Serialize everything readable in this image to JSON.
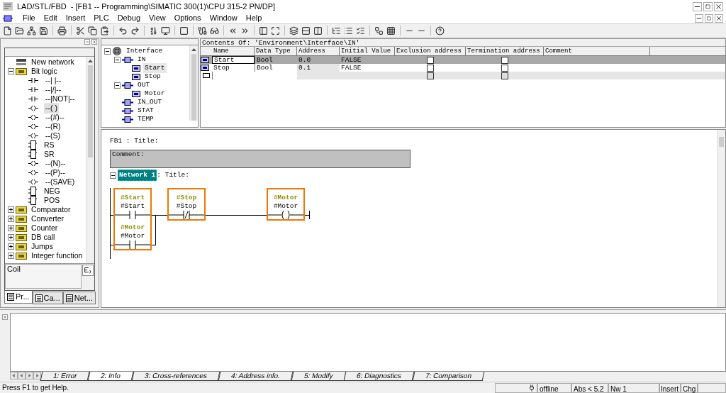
{
  "window": {
    "title": "LAD/STL/FBD  - [FB1 -- Programming\\SIMATIC 300(1)\\CPU 315-2 PN/DP]"
  },
  "menu": [
    "File",
    "Edit",
    "Insert",
    "PLC",
    "Debug",
    "View",
    "Options",
    "Window",
    "Help"
  ],
  "catalog": {
    "items": [
      {
        "label": "New network",
        "kind": "network",
        "selected": false
      },
      {
        "label": "Bit logic",
        "kind": "folder",
        "expanded": true,
        "selected": false,
        "children": [
          {
            "label": "--| |--",
            "kind": "contact",
            "selected": false
          },
          {
            "label": "--|/|--",
            "kind": "contact",
            "selected": false
          },
          {
            "label": "--|NOT|--",
            "kind": "contact",
            "selected": false
          },
          {
            "label": "--( )",
            "kind": "coil",
            "selected": true
          },
          {
            "label": "--(#)--",
            "kind": "coil",
            "selected": false
          },
          {
            "label": "--(R)",
            "kind": "coil",
            "selected": false
          },
          {
            "label": "--(S)",
            "kind": "coil",
            "selected": false
          },
          {
            "label": "RS",
            "kind": "box",
            "selected": false
          },
          {
            "label": "SR",
            "kind": "box",
            "selected": false
          },
          {
            "label": "--(N)--",
            "kind": "coil",
            "selected": false
          },
          {
            "label": "--(P)--",
            "kind": "coil",
            "selected": false
          },
          {
            "label": "--(SAVE)",
            "kind": "coil",
            "selected": false
          },
          {
            "label": "NEG",
            "kind": "box",
            "selected": false
          },
          {
            "label": "POS",
            "kind": "box",
            "selected": false
          }
        ]
      },
      {
        "label": "Comparator",
        "kind": "folder",
        "expanded": false,
        "selected": false
      },
      {
        "label": "Converter",
        "kind": "folder",
        "expanded": false,
        "selected": false
      },
      {
        "label": "Counter",
        "kind": "folder",
        "expanded": false,
        "selected": false
      },
      {
        "label": "DB call",
        "kind": "folder",
        "expanded": false,
        "selected": false
      },
      {
        "label": "Jumps",
        "kind": "folder",
        "expanded": false,
        "selected": false
      },
      {
        "label": "Integer function",
        "kind": "folder",
        "expanded": false,
        "selected": false
      }
    ],
    "description": "Coil",
    "tabs": [
      {
        "label": "Pr...",
        "selected": true
      },
      {
        "label": "Ca...",
        "selected": false
      },
      {
        "label": "Net...",
        "selected": false
      }
    ]
  },
  "interface": {
    "tree": [
      {
        "label": "Interface",
        "kind": "root",
        "expanded": true,
        "selected": false,
        "children": [
          {
            "label": "IN",
            "kind": "section",
            "expanded": true,
            "selected": false,
            "children": [
              {
                "label": "Start",
                "kind": "var",
                "selected": true
              },
              {
                "label": "Stop",
                "kind": "var",
                "selected": false
              }
            ]
          },
          {
            "label": "OUT",
            "kind": "section",
            "expanded": true,
            "selected": false,
            "children": [
              {
                "label": "Motor",
                "kind": "var",
                "selected": false
              }
            ]
          },
          {
            "label": "IN_OUT",
            "kind": "section",
            "selected": false
          },
          {
            "label": "STAT",
            "kind": "section",
            "selected": false
          },
          {
            "label": "TEMP",
            "kind": "section",
            "selected": false
          }
        ]
      }
    ],
    "path": "Contents Of: 'Environment\\Interface\\IN'",
    "columns": [
      "Name",
      "Data Type",
      "Address",
      "Initial Value",
      "Exclusion address",
      "Termination address",
      "Comment"
    ],
    "rows": [
      {
        "name": "Start",
        "type": "Bool",
        "address": "0.0",
        "initial": "FALSE",
        "exclusion": false,
        "termination": false,
        "selected": true
      },
      {
        "name": "Stop",
        "type": "Bool",
        "address": "0.1",
        "initial": "FALSE",
        "exclusion": false,
        "termination": false,
        "selected": false
      }
    ],
    "new_row": {
      "exclusion": false,
      "termination": false,
      "disabled": true
    }
  },
  "editor": {
    "block_title": "FB1 : Title:",
    "comment": "Comment:",
    "network": {
      "label": "Network 1",
      "title": ": Title:",
      "expanded": true,
      "parallel": {
        "highlighted": true,
        "contacts": [
          {
            "kind": "no",
            "symbol": "#Start",
            "operand": "#Start"
          },
          {
            "kind": "no",
            "symbol": "#Motor",
            "operand": "#Motor"
          }
        ]
      },
      "series": [
        {
          "kind": "nc",
          "symbol": "#Stop",
          "operand": "#Stop",
          "highlighted": true
        }
      ],
      "coil": {
        "kind": "coil",
        "symbol": "#Motor",
        "operand": "#Motor",
        "highlighted": true
      }
    }
  },
  "output": {
    "tabs": [
      {
        "label": "1: Error",
        "selected": false
      },
      {
        "label": "2: Info",
        "selected": true
      },
      {
        "label": "3: Cross-references",
        "selected": false
      },
      {
        "label": "4: Address info.",
        "selected": false
      },
      {
        "label": "5: Modify",
        "selected": false
      },
      {
        "label": "6: Diagnostics",
        "selected": false
      },
      {
        "label": "7: Comparison",
        "selected": false
      }
    ]
  },
  "status": {
    "help": "Press F1 to get Help.",
    "mode": "offline",
    "version": "Abs < 5.2",
    "network": "Nw 1",
    "insert": "Insert",
    "changed": "Chg"
  }
}
